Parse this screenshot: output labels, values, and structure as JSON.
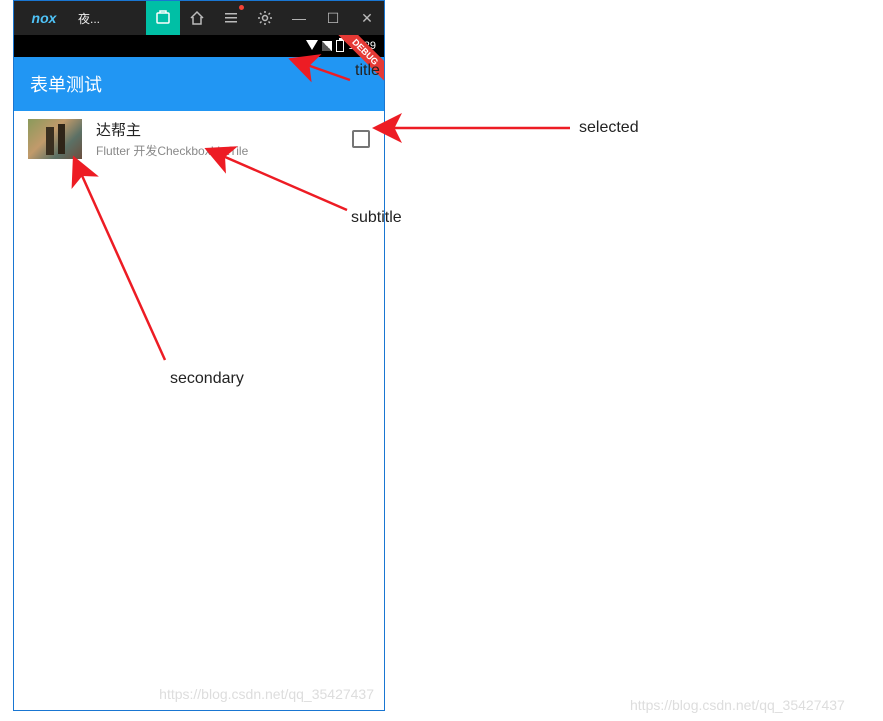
{
  "emulator": {
    "brand": "nox",
    "window_title": "夜...",
    "titlebar_icons": [
      {
        "name": "store-icon",
        "glyph": "⌂",
        "active": true
      },
      {
        "name": "home-icon",
        "glyph": "⌂"
      },
      {
        "name": "more-icon",
        "glyph": "⋮",
        "has_dot": true
      },
      {
        "name": "settings-icon",
        "glyph": "⚙"
      },
      {
        "name": "minimize-icon",
        "glyph": "—"
      },
      {
        "name": "maximize-icon",
        "glyph": "☐"
      },
      {
        "name": "close-icon",
        "glyph": "✕"
      }
    ]
  },
  "status_bar": {
    "time": "12:29"
  },
  "debug_banner": "DEBUG",
  "app": {
    "title": "表单测试",
    "tile": {
      "title": "达帮主",
      "subtitle": "Flutter 开发CheckboxListTile",
      "checked": false
    }
  },
  "annotations": {
    "title_label": "title",
    "subtitle_label": "subtitle",
    "secondary_label": "secondary",
    "selected_label": "selected"
  },
  "watermark": "https://blog.csdn.net/qq_35427437"
}
